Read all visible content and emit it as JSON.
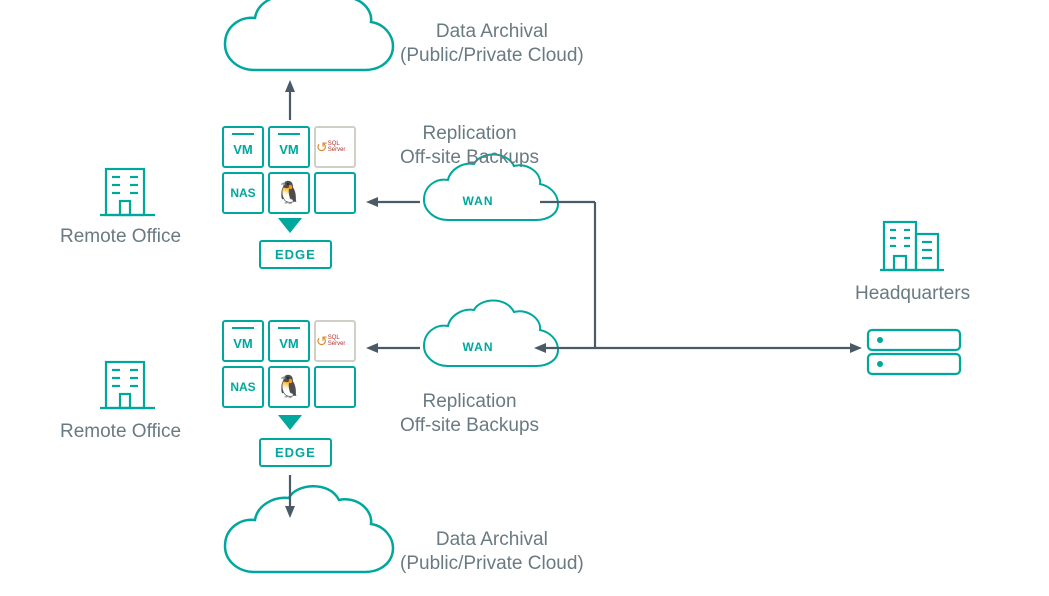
{
  "labels": {
    "remote_office": "Remote Office",
    "headquarters": "Headquarters",
    "data_archival_line1": "Data Archival",
    "data_archival_line2": "(Public/Private Cloud)",
    "replication_line1": "Replication",
    "replication_line2": "Off-site Backups",
    "wan": "WAN",
    "edge": "EDGE",
    "vm": "VM",
    "nas": "NAS",
    "sql": "SQL Server"
  }
}
